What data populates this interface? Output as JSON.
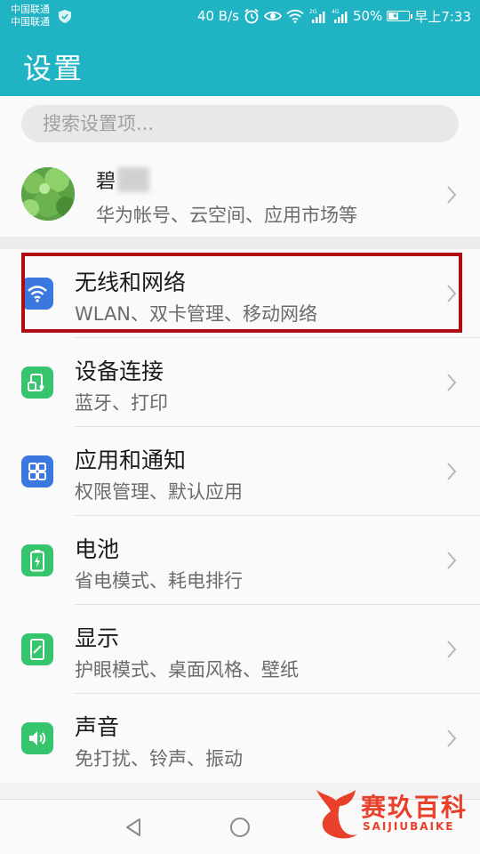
{
  "status_bar": {
    "carrier_1": "中国联通",
    "carrier_2": "中国联通",
    "net_speed": "40 B/s",
    "sim1_tech": "2G",
    "sim2_tech": "4G",
    "battery": "50%",
    "battery_level": 0.5,
    "time": "早上7:33"
  },
  "header": {
    "title": "设置"
  },
  "search": {
    "placeholder": "搜索设置项..."
  },
  "account": {
    "name": "碧",
    "subtitle": "华为帐号、云空间、应用市场等"
  },
  "settings": [
    {
      "label": "无线和网络",
      "sub": "WLAN、双卡管理、移动网络",
      "icon": "wifi-icon",
      "color": "#3a78e0",
      "highlighted": true
    },
    {
      "label": "设备连接",
      "sub": "蓝牙、打印",
      "icon": "device-connect-icon",
      "color": "#36c46d"
    },
    {
      "label": "应用和通知",
      "sub": "权限管理、默认应用",
      "icon": "apps-grid-icon",
      "color": "#3a78e0"
    },
    {
      "label": "电池",
      "sub": "省电模式、耗电排行",
      "icon": "battery-icon",
      "color": "#36c46d"
    },
    {
      "label": "显示",
      "sub": "护眼模式、桌面风格、壁纸",
      "icon": "display-icon",
      "color": "#36c46d"
    },
    {
      "label": "声音",
      "sub": "免打扰、铃声、振动",
      "icon": "sound-icon",
      "color": "#36c46d"
    }
  ],
  "watermark": {
    "title": "赛玖百科",
    "subtitle": "SAIJIUBAIKE"
  }
}
